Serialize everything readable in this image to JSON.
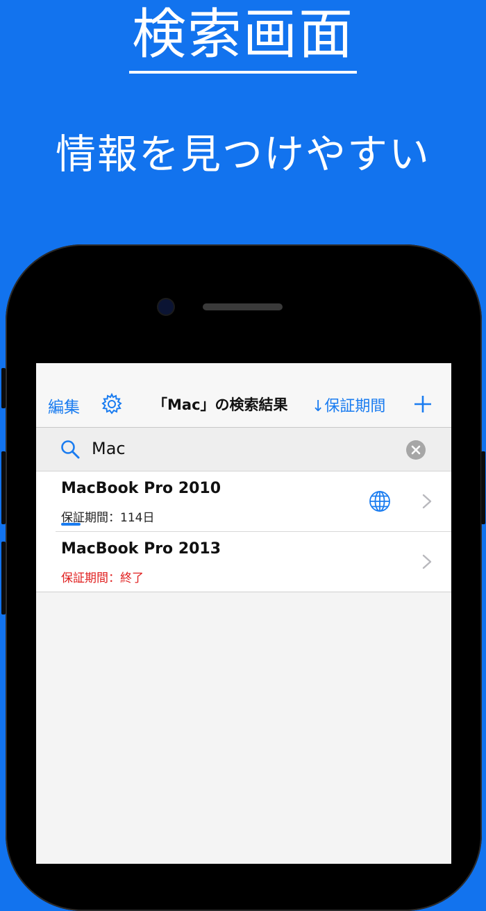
{
  "headline": "検索画面",
  "subhead": "情報を見つけやすい",
  "navbar": {
    "edit_label": "編集",
    "title": "「Mac」の検索結果",
    "sort_label": "↓保証期間"
  },
  "search": {
    "value": "Mac"
  },
  "results": [
    {
      "title": "MacBook Pro 2010",
      "warranty": "保証期間：114日",
      "expired": false,
      "has_link": true
    },
    {
      "title": "MacBook Pro 2013",
      "warranty": "保証期間：終了",
      "expired": true,
      "has_link": false
    }
  ],
  "colors": {
    "background": "#1273ee",
    "accent": "#1a7cf0",
    "expired": "#e02020"
  },
  "icons": [
    "gear-icon",
    "add-icon",
    "search-icon",
    "clear-icon",
    "globe-icon",
    "chevron-right-icon"
  ]
}
